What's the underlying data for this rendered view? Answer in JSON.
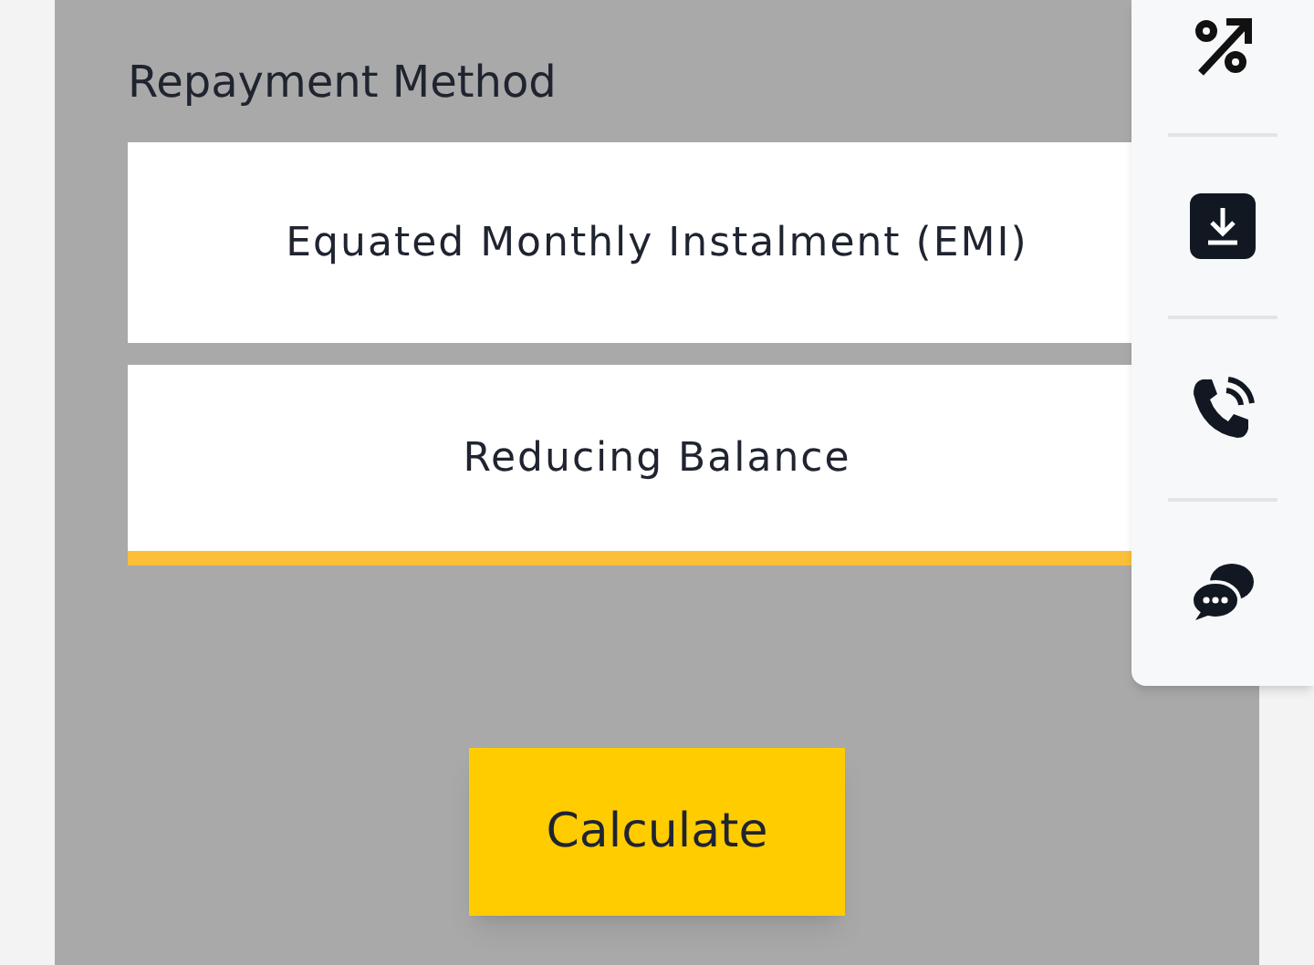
{
  "section_title": "Repayment Method",
  "options": [
    {
      "label": "Equated Monthly Instalment (EMI)",
      "selected": false
    },
    {
      "label": "Reducing Balance",
      "selected": true
    }
  ],
  "calculate_button": "Calculate",
  "side_toolbar": [
    {
      "kind": "percent"
    },
    {
      "kind": "download"
    },
    {
      "kind": "phone"
    },
    {
      "kind": "chat"
    }
  ]
}
